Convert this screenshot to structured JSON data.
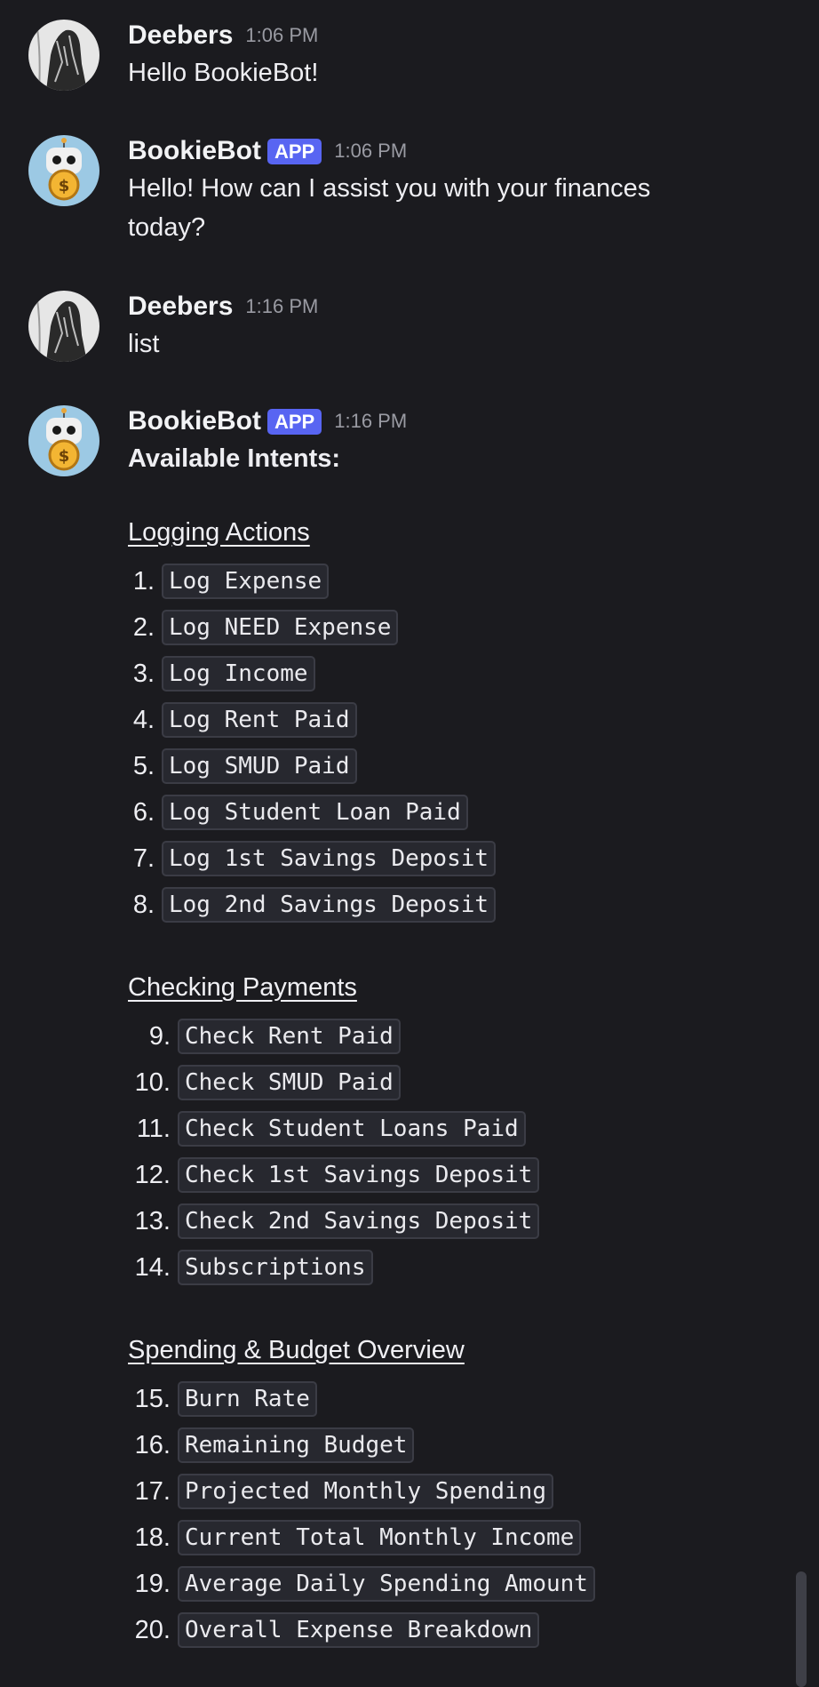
{
  "messages": [
    {
      "author": "Deebers",
      "time": "1:06 PM",
      "text": "Hello BookieBot!"
    },
    {
      "author": "BookieBot",
      "tag": "APP",
      "time": "1:06 PM",
      "text": "Hello! How can I assist you with your finances today?"
    },
    {
      "author": "Deebers",
      "time": "1:16 PM",
      "text": "list"
    },
    {
      "author": "BookieBot",
      "tag": "APP",
      "time": "1:16 PM",
      "heading": "Available Intents:",
      "sections": [
        {
          "title": "Logging Actions",
          "items": [
            {
              "n": "1.",
              "label": "Log Expense"
            },
            {
              "n": "2.",
              "label": "Log NEED Expense"
            },
            {
              "n": "3.",
              "label": "Log Income"
            },
            {
              "n": "4.",
              "label": "Log Rent Paid"
            },
            {
              "n": "5.",
              "label": "Log SMUD Paid"
            },
            {
              "n": "6.",
              "label": "Log Student Loan Paid"
            },
            {
              "n": "7.",
              "label": "Log 1st Savings Deposit"
            },
            {
              "n": "8.",
              "label": "Log 2nd Savings Deposit"
            }
          ]
        },
        {
          "title": "Checking Payments",
          "items": [
            {
              "n": "9.",
              "label": "Check Rent Paid"
            },
            {
              "n": "10.",
              "label": "Check SMUD Paid"
            },
            {
              "n": "11.",
              "label": "Check Student Loans Paid"
            },
            {
              "n": "12.",
              "label": "Check 1st Savings Deposit"
            },
            {
              "n": "13.",
              "label": "Check 2nd Savings Deposit"
            },
            {
              "n": "14.",
              "label": "Subscriptions"
            }
          ]
        },
        {
          "title": "Spending & Budget Overview",
          "items": [
            {
              "n": "15.",
              "label": "Burn Rate"
            },
            {
              "n": "16.",
              "label": "Remaining Budget"
            },
            {
              "n": "17.",
              "label": "Projected Monthly Spending"
            },
            {
              "n": "18.",
              "label": "Current Total Monthly Income"
            },
            {
              "n": "19.",
              "label": "Average Daily Spending Amount"
            },
            {
              "n": "20.",
              "label": "Overall Expense Breakdown"
            }
          ]
        }
      ]
    }
  ],
  "colors": {
    "background": "#1b1b1f",
    "app_tag": "#5865f2",
    "timestamp": "#9a9ba3",
    "code_bg": "#27282f"
  },
  "icons": {
    "user_avatar": "sketch-avatar-icon",
    "bot_avatar": "robot-coin-avatar-icon"
  }
}
